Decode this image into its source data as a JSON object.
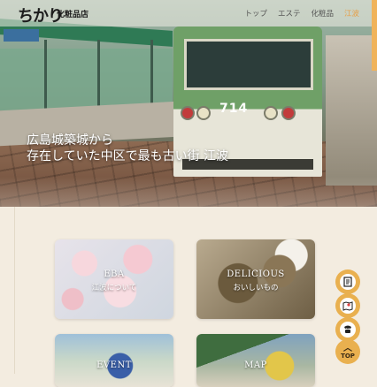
{
  "header": {
    "logo_mark": "ちかり",
    "logo_text": "化粧品店",
    "nav": [
      {
        "label": "トップ",
        "active": false
      },
      {
        "label": "エステ",
        "active": false
      },
      {
        "label": "化粧品",
        "active": false
      },
      {
        "label": "江波",
        "active": true
      }
    ]
  },
  "hero": {
    "caption_line1": "広島城築城から",
    "caption_line2": "存在していた中区で最も古い街 江波",
    "tram_number": "714"
  },
  "cards": {
    "eba": {
      "en": "EBA",
      "jp": "江波について"
    },
    "food": {
      "en": "DELICIOUS",
      "jp": "おいしいもの"
    },
    "event": {
      "en": "EVENT"
    },
    "map": {
      "en": "MAP"
    }
  },
  "fabs": {
    "menu_icon": "menu-book-icon",
    "map_icon": "map-icon",
    "phone_icon": "phone-icon",
    "top_label": "TOP"
  },
  "colors": {
    "accent": "#e9b04f",
    "nav_active": "#e6a04a",
    "background": "#f3ece0"
  }
}
